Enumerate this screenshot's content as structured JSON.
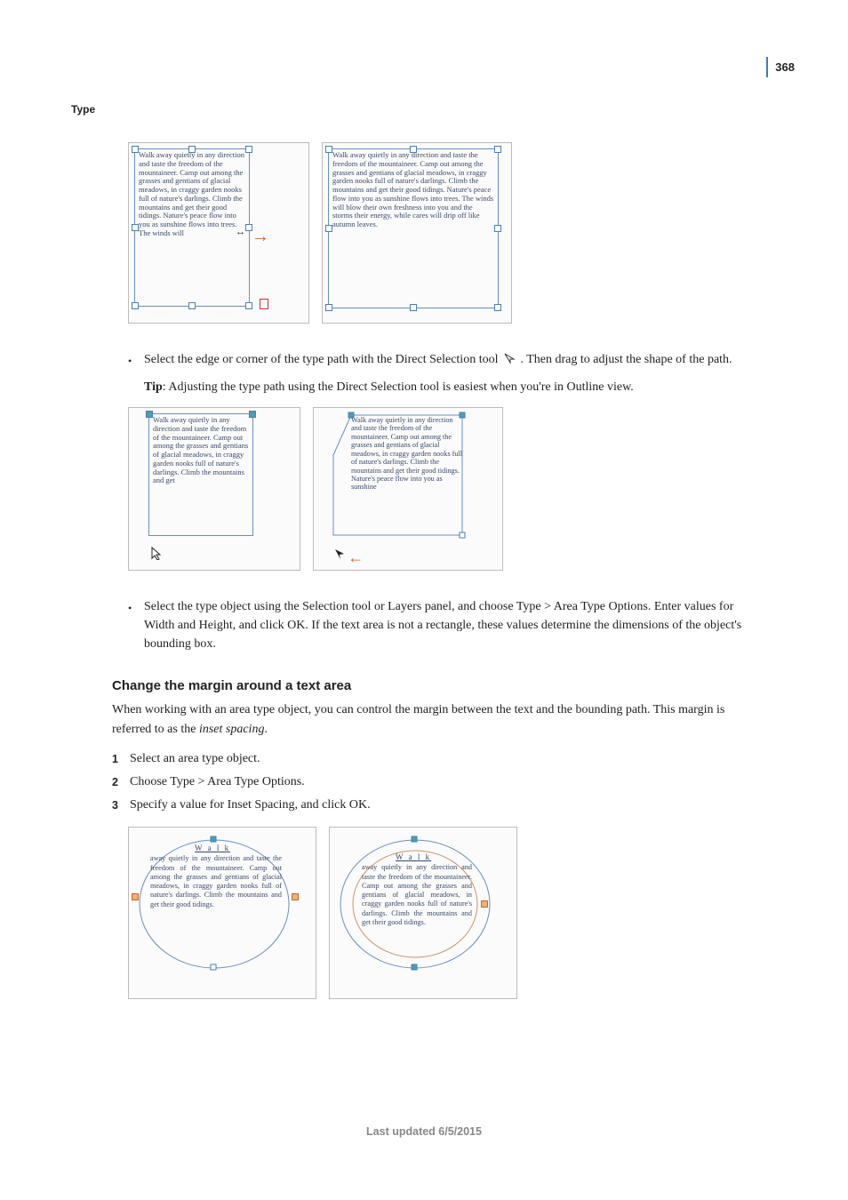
{
  "page_number": "368",
  "section_label": "Type",
  "figure1_text_a": "Walk away quietly in any direction and taste the freedom of the mountaineer. Camp out among the grasses and gentians of glacial meadows, in craggy garden nooks full of nature's darlings. Climb the mountains and get their good tidings. Nature's peace flow into you as sunshine flows into trees. The winds will",
  "figure1_text_b": "Walk away quietly in any direction and taste the freedom of the mountaineer. Camp out among the grasses and gentians of glacial meadows, in craggy garden nooks full of nature's darlings. Climb the mountains and get their good tidings. Nature's peace flow into you as sunshine flows into trees. The winds will blow their own freshness into you and the storms their energy, while cares will drip off like autumn leaves.",
  "bullet1_text_a": "Select the edge or corner of the type path with the Direct Selection tool ",
  "bullet1_text_b": " . Then drag to adjust the shape of the path.",
  "tip_label": "Tip",
  "tip_text": ": Adjusting the type path using the Direct Selection tool is easiest when you're in Outline view.",
  "figure2_text_a": "Walk away quietly in any direction and taste the freedom of the mountaineer. Camp out among the grasses and gentians of glacial meadows, in craggy garden nooks full of nature's darlings. Climb the mountains and get",
  "figure2_text_b": "Walk away quietly in any direction and taste the freedom of the mountaineer. Camp out among the grasses and gentians of glacial meadows, in craggy garden nooks full of nature's darlings. Climb the mountains and get their good tidings. Nature's peace flow into you as sunshine",
  "bullet2_text": "Select the type object using the Selection tool or Layers panel, and choose Type > Area Type Options. Enter values for Width and Height, and click OK. If the text area is not a rectangle, these values determine the dimensions of the object's bounding box.",
  "heading": "Change the margin around a text area",
  "para1_a": "When working with an area type object, you can control the margin between the text and the bounding path. This margin is referred to as the ",
  "para1_i": "inset spacing",
  "para1_b": ".",
  "step1": "Select an area type object.",
  "step2": "Choose Type > Area Type Options.",
  "step3": "Specify a value for Inset Spacing, and click OK.",
  "figure3_title": "W a l k",
  "figure3_text_a": "away quietly in any direction and taste the freedom of the mountaineer. Camp out among the grasses and gentians of glacial meadows, in craggy garden nooks full of nature's darlings. Climb the mountains and get their good tidings.",
  "figure3_text_b": "away quietly in any direction and taste the freedom of the mountaineer. Camp out among the grasses and gentians of glacial meadows, in craggy garden nooks full of nature's darlings. Climb the mountains and get their good tidings.",
  "footer": "Last updated 6/5/2015"
}
